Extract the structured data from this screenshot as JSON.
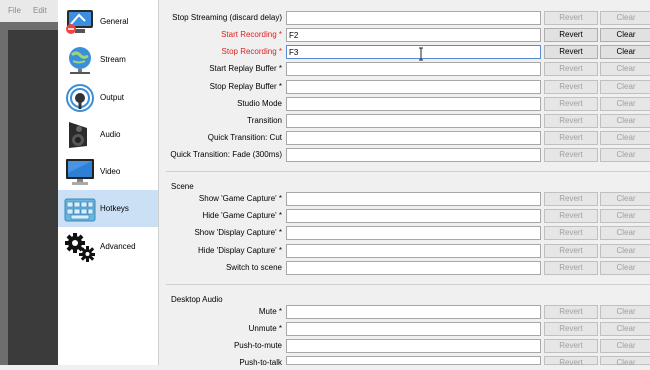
{
  "menu": {
    "file": "File",
    "edit": "Edit"
  },
  "nav": [
    {
      "label": "General",
      "icon": "monitor-settings-icon"
    },
    {
      "label": "Stream",
      "icon": "globe-network-icon"
    },
    {
      "label": "Output",
      "icon": "output-signal-icon"
    },
    {
      "label": "Audio",
      "icon": "speaker-icon"
    },
    {
      "label": "Video",
      "icon": "monitor-icon"
    },
    {
      "label": "Hotkeys",
      "icon": "keyboard-icon",
      "active": true
    },
    {
      "label": "Advanced",
      "icon": "gears-icon"
    }
  ],
  "buttons": {
    "revert": "Revert",
    "clear": "Clear"
  },
  "hotkeys": [
    {
      "label": "Stop Streaming (discard delay)",
      "value": ""
    },
    {
      "label": "Start Recording *",
      "value": "F2",
      "modified": true
    },
    {
      "label": "Stop Recording *",
      "value": "F3",
      "modified": true
    },
    {
      "label": "Start Replay Buffer *",
      "value": ""
    },
    {
      "label": "Stop Replay Buffer *",
      "value": ""
    },
    {
      "label": "Studio Mode",
      "value": ""
    },
    {
      "label": "Transition",
      "value": ""
    },
    {
      "label": "Quick Transition: Cut",
      "value": ""
    },
    {
      "label": "Quick Transition: Fade (300ms)",
      "value": ""
    }
  ],
  "scene": {
    "title": "Scene",
    "rows": [
      {
        "label": "Show 'Game Capture' *",
        "value": ""
      },
      {
        "label": "Hide 'Game Capture' *",
        "value": ""
      },
      {
        "label": "Show 'Display Capture' *",
        "value": ""
      },
      {
        "label": "Hide 'Display Capture' *",
        "value": ""
      },
      {
        "label": "Switch to scene",
        "value": ""
      }
    ]
  },
  "desktop_audio": {
    "title": "Desktop Audio",
    "rows": [
      {
        "label": "Mute *",
        "value": ""
      },
      {
        "label": "Unmute *",
        "value": ""
      },
      {
        "label": "Push-to-mute",
        "value": ""
      },
      {
        "label": "Push-to-talk",
        "value": ""
      }
    ]
  },
  "colors": {
    "modified_label": "#dd2222",
    "active_nav": "#cce0f5"
  }
}
